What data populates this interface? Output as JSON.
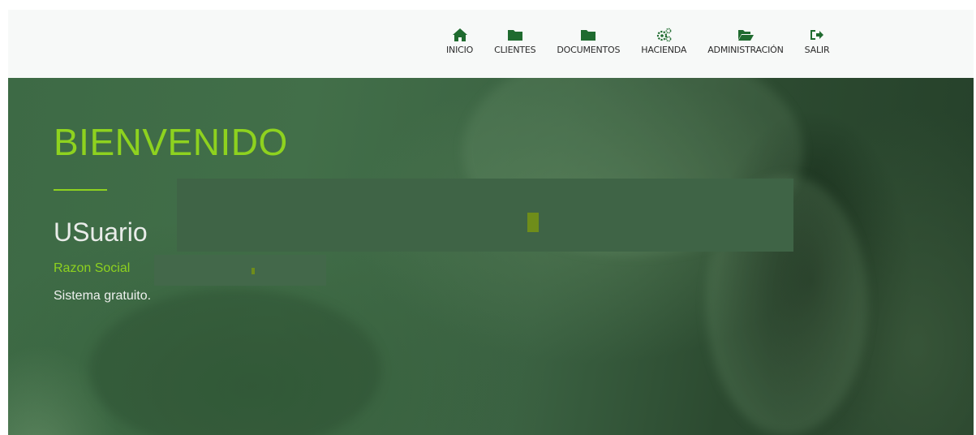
{
  "nav": {
    "items": [
      {
        "label": "INICIO",
        "icon": "home-icon"
      },
      {
        "label": "CLIENTES",
        "icon": "folder-icon"
      },
      {
        "label": "DOCUMENTOS",
        "icon": "folder-icon"
      },
      {
        "label": "HACIENDA",
        "icon": "gears-icon"
      },
      {
        "label": "ADMINISTRACIÓN",
        "icon": "folder-open-icon"
      },
      {
        "label": "SALIR",
        "icon": "sign-out-icon"
      }
    ],
    "icon_color": "#1f6b2f"
  },
  "hero": {
    "title": "BIENVENIDO",
    "user_label": "USuario",
    "razon_label": "Razon Social",
    "description": "Sistema gratuito.",
    "accent_color": "#8ed21f"
  }
}
